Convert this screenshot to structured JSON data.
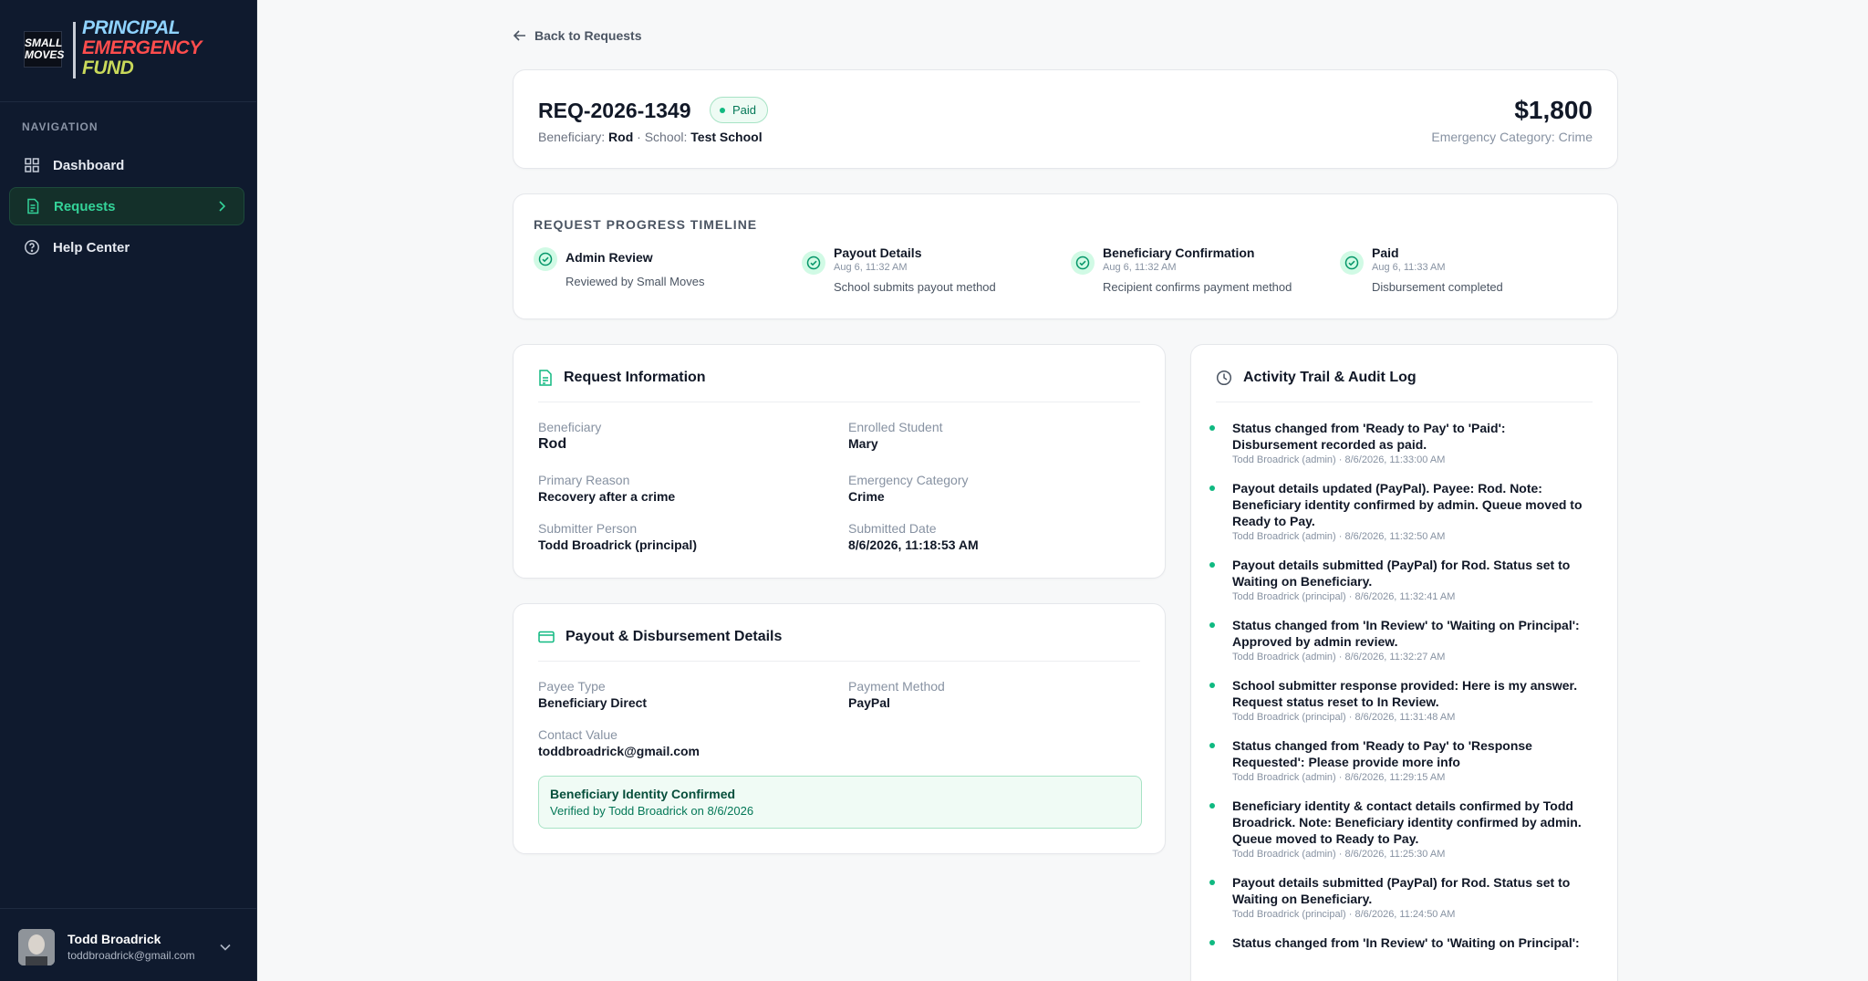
{
  "brand": {
    "small_logo": "SMALL MOVES",
    "title_line1": "PRINCIPAL",
    "title_line2": "EMERGENCY",
    "title_line3": "FUND"
  },
  "sidebar": {
    "heading": "NAVIGATION",
    "items": [
      {
        "label": "Dashboard",
        "icon": "grid-icon"
      },
      {
        "label": "Requests",
        "icon": "document-icon",
        "active": true
      },
      {
        "label": "Help Center",
        "icon": "help-icon"
      }
    ]
  },
  "user": {
    "name": "Todd Broadrick",
    "email": "toddbroadrick@gmail.com"
  },
  "back_link": "Back to Requests",
  "request": {
    "id": "REQ-2026-1349",
    "status": "Paid",
    "beneficiary_label": "Beneficiary:",
    "beneficiary": "Rod",
    "school_label": "· School:",
    "school": "Test School",
    "amount": "$1,800",
    "category_line": "Emergency Category: Crime"
  },
  "timeline": {
    "title": "REQUEST PROGRESS TIMELINE",
    "steps": [
      {
        "title": "Admin Review",
        "time": "",
        "desc": "Reviewed by Small Moves"
      },
      {
        "title": "Payout Details",
        "time": "Aug 6, 11:32 AM",
        "desc": "School submits payout method"
      },
      {
        "title": "Beneficiary Confirmation",
        "time": "Aug 6, 11:32 AM",
        "desc": "Recipient confirms payment method"
      },
      {
        "title": "Paid",
        "time": "Aug 6, 11:33 AM",
        "desc": "Disbursement completed"
      }
    ]
  },
  "info": {
    "title": "Request Information",
    "fields": [
      {
        "label": "Beneficiary",
        "value": "Rod"
      },
      {
        "label": "Enrolled Student",
        "value": "Mary"
      },
      {
        "label": "Primary Reason",
        "value": "Recovery after a crime"
      },
      {
        "label": "Emergency Category",
        "value": "Crime"
      },
      {
        "label": "Submitter Person",
        "value": "Todd Broadrick (principal)"
      },
      {
        "label": "Submitted Date",
        "value": "8/6/2026, 11:18:53 AM"
      }
    ]
  },
  "payout": {
    "title": "Payout & Disbursement Details",
    "fields": [
      {
        "label": "Payee Type",
        "value": "Beneficiary Direct"
      },
      {
        "label": "Payment Method",
        "value": "PayPal"
      },
      {
        "label": "Contact Value",
        "value": "toddbroadrick@gmail.com"
      }
    ],
    "confirm_title": "Beneficiary Identity Confirmed",
    "confirm_sub": "Verified by Todd Broadrick on 8/6/2026"
  },
  "audit": {
    "title": "Activity Trail & Audit Log",
    "entries": [
      {
        "text": "Status changed from 'Ready to Pay' to 'Paid': Disbursement recorded as paid.",
        "meta": "Todd Broadrick (admin) · 8/6/2026, 11:33:00 AM"
      },
      {
        "text": "Payout details updated (PayPal). Payee: Rod. Note: Beneficiary identity confirmed by admin. Queue moved to Ready to Pay.",
        "meta": "Todd Broadrick (admin) · 8/6/2026, 11:32:50 AM"
      },
      {
        "text": "Payout details submitted (PayPal) for Rod. Status set to Waiting on Beneficiary.",
        "meta": "Todd Broadrick (principal) · 8/6/2026, 11:32:41 AM"
      },
      {
        "text": "Status changed from 'In Review' to 'Waiting on Principal': Approved by admin review.",
        "meta": "Todd Broadrick (admin) · 8/6/2026, 11:32:27 AM"
      },
      {
        "text": "School submitter response provided: Here is my answer. Request status reset to In Review.",
        "meta": "Todd Broadrick (principal) · 8/6/2026, 11:31:48 AM"
      },
      {
        "text": "Status changed from 'Ready to Pay' to 'Response Requested': Please provide more info",
        "meta": "Todd Broadrick (admin) · 8/6/2026, 11:29:15 AM"
      },
      {
        "text": "Beneficiary identity & contact details confirmed by Todd Broadrick. Note: Beneficiary identity confirmed by admin. Queue moved to Ready to Pay.",
        "meta": "Todd Broadrick (admin) · 8/6/2026, 11:25:30 AM"
      },
      {
        "text": "Payout details submitted (PayPal) for Rod. Status set to Waiting on Beneficiary.",
        "meta": "Todd Broadrick (principal) · 8/6/2026, 11:24:50 AM"
      },
      {
        "text": "Status changed from 'In Review' to 'Waiting on Principal':",
        "meta": ""
      }
    ]
  },
  "colors": {
    "sidebar_bg": "#0f1a2e",
    "accent": "#10b981",
    "active_nav_text": "#34d399"
  }
}
